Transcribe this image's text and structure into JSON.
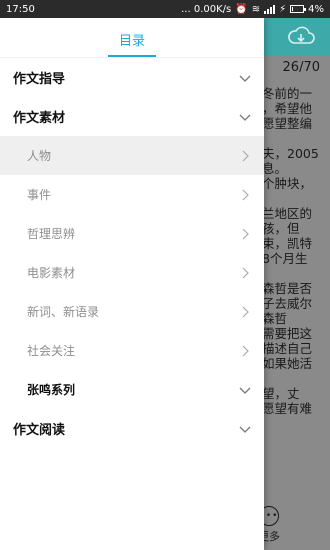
{
  "status_bar": {
    "time": "17:50",
    "network_speed": "... 0.00K/s",
    "battery_percent": "4%"
  },
  "background_reader": {
    "page_indicator": "26/70",
    "text_fragments": "冬前的一\n，希望他\n愿望整编\n\n夫，2005\n息。\n个肿块，\n\n兰地区的\n孩，但\n束，凯特\n8个月生\n\n森哲是否\n子去威尔\n森哲\n需要把这\n描述自己\n如果她活\n\n望，丈\n愿望有难",
    "more_label": "更多"
  },
  "drawer": {
    "title": "目录",
    "items": [
      {
        "label": "作文指导",
        "level": "top",
        "icon": "chevron-down-icon"
      },
      {
        "label": "作文素材",
        "level": "top",
        "icon": "chevron-down-icon"
      },
      {
        "label": "人物",
        "level": "sub",
        "icon": "chevron-right-icon",
        "selected": true
      },
      {
        "label": "事件",
        "level": "sub",
        "icon": "chevron-right-icon"
      },
      {
        "label": "哲理思辨",
        "level": "sub",
        "icon": "chevron-right-icon"
      },
      {
        "label": "电影素材",
        "level": "sub",
        "icon": "chevron-right-icon"
      },
      {
        "label": "新词、新语录",
        "level": "sub",
        "icon": "chevron-right-icon"
      },
      {
        "label": "社会关注",
        "level": "sub",
        "icon": "chevron-right-icon"
      },
      {
        "label": "张鸣系列",
        "level": "sub-bold",
        "icon": "chevron-down-icon"
      },
      {
        "label": "作文阅读",
        "level": "top",
        "icon": "chevron-down-icon"
      }
    ]
  },
  "colors": {
    "accent": "#1aa9d8",
    "reader_topbar": "#3ea9a9",
    "selected_row": "#efefef"
  }
}
